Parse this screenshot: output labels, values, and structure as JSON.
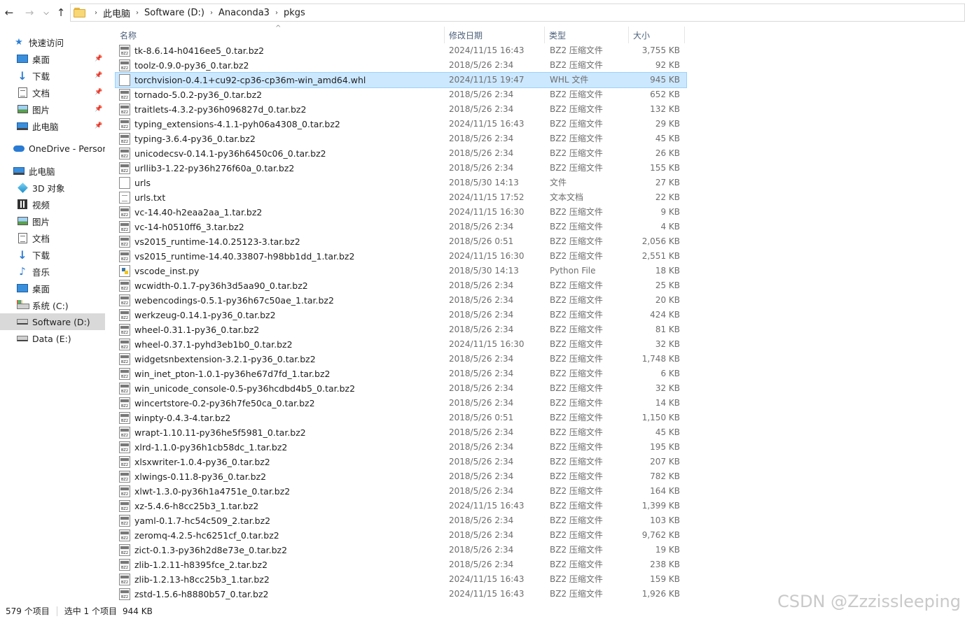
{
  "breadcrumb": [
    "此电脑",
    "Software (D:)",
    "Anaconda3",
    "pkgs"
  ],
  "sidebar": {
    "items": [
      {
        "label": "快速访问",
        "icon": "star-icon",
        "indent": 0,
        "pinned": false,
        "selected": false,
        "gap": 0
      },
      {
        "label": "桌面",
        "icon": "desktop-icon",
        "indent": 1,
        "pinned": true,
        "selected": false,
        "gap": 0
      },
      {
        "label": "下载",
        "icon": "download-icon",
        "indent": 1,
        "pinned": true,
        "selected": false,
        "gap": 0
      },
      {
        "label": "文档",
        "icon": "document-icon",
        "indent": 1,
        "pinned": true,
        "selected": false,
        "gap": 0
      },
      {
        "label": "图片",
        "icon": "picture-icon",
        "indent": 1,
        "pinned": true,
        "selected": false,
        "gap": 0
      },
      {
        "label": "此电脑",
        "icon": "pc-icon",
        "indent": 1,
        "pinned": true,
        "selected": false,
        "gap": 0
      },
      {
        "label": "OneDrive - Persona",
        "icon": "onedrive-icon",
        "indent": 0,
        "pinned": false,
        "selected": false,
        "gap": 1
      },
      {
        "label": "此电脑",
        "icon": "pc-icon",
        "indent": 0,
        "pinned": false,
        "selected": false,
        "gap": 1
      },
      {
        "label": "3D 对象",
        "icon": "3d-objects-icon",
        "indent": 1,
        "pinned": false,
        "selected": false,
        "gap": 0
      },
      {
        "label": "视频",
        "icon": "video-icon",
        "indent": 1,
        "pinned": false,
        "selected": false,
        "gap": 0
      },
      {
        "label": "图片",
        "icon": "picture-icon",
        "indent": 1,
        "pinned": false,
        "selected": false,
        "gap": 0
      },
      {
        "label": "文档",
        "icon": "document-icon",
        "indent": 1,
        "pinned": false,
        "selected": false,
        "gap": 0
      },
      {
        "label": "下载",
        "icon": "download-icon",
        "indent": 1,
        "pinned": false,
        "selected": false,
        "gap": 0
      },
      {
        "label": "音乐",
        "icon": "music-icon",
        "indent": 1,
        "pinned": false,
        "selected": false,
        "gap": 0
      },
      {
        "label": "桌面",
        "icon": "desktop-icon",
        "indent": 1,
        "pinned": false,
        "selected": false,
        "gap": 0
      },
      {
        "label": "系统 (C:)",
        "icon": "system-drive-icon",
        "indent": 1,
        "pinned": false,
        "selected": false,
        "gap": 0
      },
      {
        "label": "Software (D:)",
        "icon": "drive-icon",
        "indent": 1,
        "pinned": false,
        "selected": true,
        "gap": 0
      },
      {
        "label": "Data (E:)",
        "icon": "drive-icon",
        "indent": 1,
        "pinned": false,
        "selected": false,
        "gap": 0
      }
    ]
  },
  "columns": {
    "name": "名称",
    "date": "修改日期",
    "type": "类型",
    "size": "大小"
  },
  "files": [
    {
      "name": "tk-8.6.14-h0416ee5_0.tar.bz2",
      "date": "2024/11/15 16:43",
      "type": "BZ2 压缩文件",
      "size": "3,755 KB",
      "icon": "bz2",
      "selected": false
    },
    {
      "name": "toolz-0.9.0-py36_0.tar.bz2",
      "date": "2018/5/26 2:34",
      "type": "BZ2 压缩文件",
      "size": "92 KB",
      "icon": "bz2",
      "selected": false
    },
    {
      "name": "torchvision-0.4.1+cu92-cp36-cp36m-win_amd64.whl",
      "date": "2024/11/15 19:47",
      "type": "WHL 文件",
      "size": "945 KB",
      "icon": "generic",
      "selected": true
    },
    {
      "name": "tornado-5.0.2-py36_0.tar.bz2",
      "date": "2018/5/26 2:34",
      "type": "BZ2 压缩文件",
      "size": "652 KB",
      "icon": "bz2",
      "selected": false
    },
    {
      "name": "traitlets-4.3.2-py36h096827d_0.tar.bz2",
      "date": "2018/5/26 2:34",
      "type": "BZ2 压缩文件",
      "size": "132 KB",
      "icon": "bz2",
      "selected": false
    },
    {
      "name": "typing_extensions-4.1.1-pyh06a4308_0.tar.bz2",
      "date": "2024/11/15 16:43",
      "type": "BZ2 压缩文件",
      "size": "29 KB",
      "icon": "bz2",
      "selected": false
    },
    {
      "name": "typing-3.6.4-py36_0.tar.bz2",
      "date": "2018/5/26 2:34",
      "type": "BZ2 压缩文件",
      "size": "45 KB",
      "icon": "bz2",
      "selected": false
    },
    {
      "name": "unicodecsv-0.14.1-py36h6450c06_0.tar.bz2",
      "date": "2018/5/26 2:34",
      "type": "BZ2 压缩文件",
      "size": "26 KB",
      "icon": "bz2",
      "selected": false
    },
    {
      "name": "urllib3-1.22-py36h276f60a_0.tar.bz2",
      "date": "2018/5/26 2:34",
      "type": "BZ2 压缩文件",
      "size": "155 KB",
      "icon": "bz2",
      "selected": false
    },
    {
      "name": "urls",
      "date": "2018/5/30 14:13",
      "type": "文件",
      "size": "27 KB",
      "icon": "generic",
      "selected": false
    },
    {
      "name": "urls.txt",
      "date": "2024/11/15 17:52",
      "type": "文本文档",
      "size": "22 KB",
      "icon": "txt",
      "selected": false
    },
    {
      "name": "vc-14.40-h2eaa2aa_1.tar.bz2",
      "date": "2024/11/15 16:30",
      "type": "BZ2 压缩文件",
      "size": "9 KB",
      "icon": "bz2",
      "selected": false
    },
    {
      "name": "vc-14-h0510ff6_3.tar.bz2",
      "date": "2018/5/26 2:34",
      "type": "BZ2 压缩文件",
      "size": "4 KB",
      "icon": "bz2",
      "selected": false
    },
    {
      "name": "vs2015_runtime-14.0.25123-3.tar.bz2",
      "date": "2018/5/26 0:51",
      "type": "BZ2 压缩文件",
      "size": "2,056 KB",
      "icon": "bz2",
      "selected": false
    },
    {
      "name": "vs2015_runtime-14.40.33807-h98bb1dd_1.tar.bz2",
      "date": "2024/11/15 16:30",
      "type": "BZ2 压缩文件",
      "size": "2,551 KB",
      "icon": "bz2",
      "selected": false
    },
    {
      "name": "vscode_inst.py",
      "date": "2018/5/30 14:13",
      "type": "Python File",
      "size": "18 KB",
      "icon": "py",
      "selected": false
    },
    {
      "name": "wcwidth-0.1.7-py36h3d5aa90_0.tar.bz2",
      "date": "2018/5/26 2:34",
      "type": "BZ2 压缩文件",
      "size": "25 KB",
      "icon": "bz2",
      "selected": false
    },
    {
      "name": "webencodings-0.5.1-py36h67c50ae_1.tar.bz2",
      "date": "2018/5/26 2:34",
      "type": "BZ2 压缩文件",
      "size": "20 KB",
      "icon": "bz2",
      "selected": false
    },
    {
      "name": "werkzeug-0.14.1-py36_0.tar.bz2",
      "date": "2018/5/26 2:34",
      "type": "BZ2 压缩文件",
      "size": "424 KB",
      "icon": "bz2",
      "selected": false
    },
    {
      "name": "wheel-0.31.1-py36_0.tar.bz2",
      "date": "2018/5/26 2:34",
      "type": "BZ2 压缩文件",
      "size": "81 KB",
      "icon": "bz2",
      "selected": false
    },
    {
      "name": "wheel-0.37.1-pyhd3eb1b0_0.tar.bz2",
      "date": "2024/11/15 16:30",
      "type": "BZ2 压缩文件",
      "size": "32 KB",
      "icon": "bz2",
      "selected": false
    },
    {
      "name": "widgetsnbextension-3.2.1-py36_0.tar.bz2",
      "date": "2018/5/26 2:34",
      "type": "BZ2 压缩文件",
      "size": "1,748 KB",
      "icon": "bz2",
      "selected": false
    },
    {
      "name": "win_inet_pton-1.0.1-py36he67d7fd_1.tar.bz2",
      "date": "2018/5/26 2:34",
      "type": "BZ2 压缩文件",
      "size": "6 KB",
      "icon": "bz2",
      "selected": false
    },
    {
      "name": "win_unicode_console-0.5-py36hcdbd4b5_0.tar.bz2",
      "date": "2018/5/26 2:34",
      "type": "BZ2 压缩文件",
      "size": "32 KB",
      "icon": "bz2",
      "selected": false
    },
    {
      "name": "wincertstore-0.2-py36h7fe50ca_0.tar.bz2",
      "date": "2018/5/26 2:34",
      "type": "BZ2 压缩文件",
      "size": "14 KB",
      "icon": "bz2",
      "selected": false
    },
    {
      "name": "winpty-0.4.3-4.tar.bz2",
      "date": "2018/5/26 0:51",
      "type": "BZ2 压缩文件",
      "size": "1,150 KB",
      "icon": "bz2",
      "selected": false
    },
    {
      "name": "wrapt-1.10.11-py36he5f5981_0.tar.bz2",
      "date": "2018/5/26 2:34",
      "type": "BZ2 压缩文件",
      "size": "45 KB",
      "icon": "bz2",
      "selected": false
    },
    {
      "name": "xlrd-1.1.0-py36h1cb58dc_1.tar.bz2",
      "date": "2018/5/26 2:34",
      "type": "BZ2 压缩文件",
      "size": "195 KB",
      "icon": "bz2",
      "selected": false
    },
    {
      "name": "xlsxwriter-1.0.4-py36_0.tar.bz2",
      "date": "2018/5/26 2:34",
      "type": "BZ2 压缩文件",
      "size": "207 KB",
      "icon": "bz2",
      "selected": false
    },
    {
      "name": "xlwings-0.11.8-py36_0.tar.bz2",
      "date": "2018/5/26 2:34",
      "type": "BZ2 压缩文件",
      "size": "782 KB",
      "icon": "bz2",
      "selected": false
    },
    {
      "name": "xlwt-1.3.0-py36h1a4751e_0.tar.bz2",
      "date": "2018/5/26 2:34",
      "type": "BZ2 压缩文件",
      "size": "164 KB",
      "icon": "bz2",
      "selected": false
    },
    {
      "name": "xz-5.4.6-h8cc25b3_1.tar.bz2",
      "date": "2024/11/15 16:43",
      "type": "BZ2 压缩文件",
      "size": "1,399 KB",
      "icon": "bz2",
      "selected": false
    },
    {
      "name": "yaml-0.1.7-hc54c509_2.tar.bz2",
      "date": "2018/5/26 2:34",
      "type": "BZ2 压缩文件",
      "size": "103 KB",
      "icon": "bz2",
      "selected": false
    },
    {
      "name": "zeromq-4.2.5-hc6251cf_0.tar.bz2",
      "date": "2018/5/26 2:34",
      "type": "BZ2 压缩文件",
      "size": "9,762 KB",
      "icon": "bz2",
      "selected": false
    },
    {
      "name": "zict-0.1.3-py36h2d8e73e_0.tar.bz2",
      "date": "2018/5/26 2:34",
      "type": "BZ2 压缩文件",
      "size": "19 KB",
      "icon": "bz2",
      "selected": false
    },
    {
      "name": "zlib-1.2.11-h8395fce_2.tar.bz2",
      "date": "2018/5/26 2:34",
      "type": "BZ2 压缩文件",
      "size": "238 KB",
      "icon": "bz2",
      "selected": false
    },
    {
      "name": "zlib-1.2.13-h8cc25b3_1.tar.bz2",
      "date": "2024/11/15 16:43",
      "type": "BZ2 压缩文件",
      "size": "159 KB",
      "icon": "bz2",
      "selected": false
    },
    {
      "name": "zstd-1.5.6-h8880b57_0.tar.bz2",
      "date": "2024/11/15 16:43",
      "type": "BZ2 压缩文件",
      "size": "1,926 KB",
      "icon": "bz2",
      "selected": false
    }
  ],
  "status": {
    "item_count": "579 个项目",
    "selection": "选中 1 个项目",
    "selection_size": "944 KB"
  },
  "watermark": "CSDN @Zzzissleeping",
  "colors": {
    "selection_bg": "#cce8ff",
    "selection_border": "#99d1ff",
    "sidebar_selected": "#d9d9d9",
    "header_text": "#4c607a"
  }
}
